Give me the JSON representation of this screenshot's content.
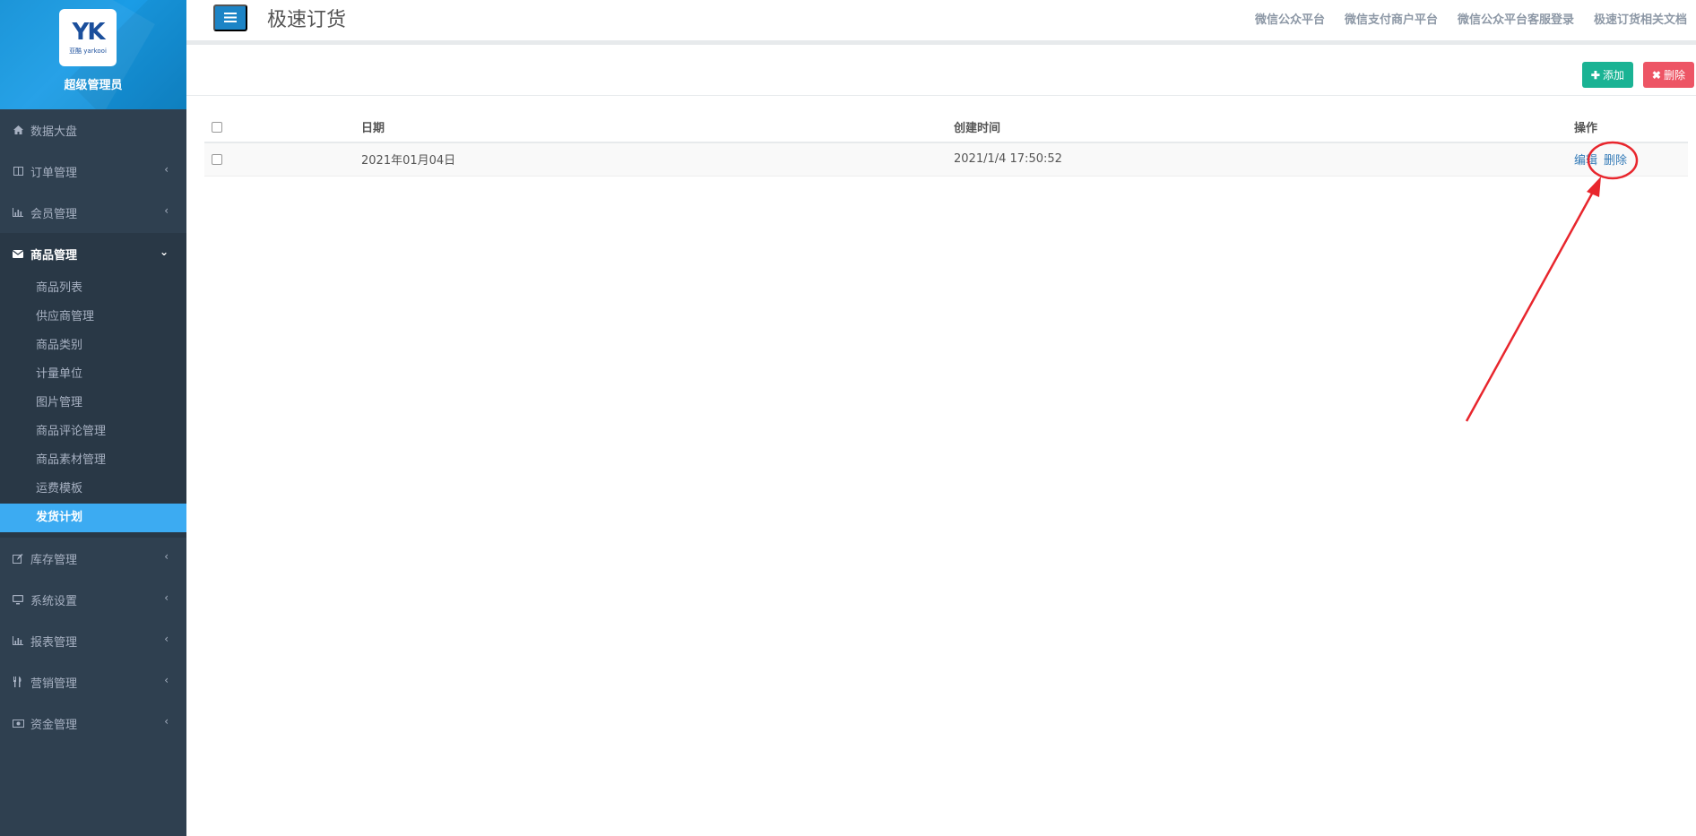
{
  "sidebar": {
    "logo_mark": "YK",
    "logo_sub": "亚酷 yarkooi",
    "profile_name": "超级管理员",
    "items": [
      {
        "label": "数据大盘",
        "icon": "home-icon",
        "has_arrow": false
      },
      {
        "label": "订单管理",
        "icon": "columns-icon",
        "has_arrow": true
      },
      {
        "label": "会员管理",
        "icon": "bar-chart-icon",
        "has_arrow": true
      },
      {
        "label": "商品管理",
        "icon": "envelope-icon",
        "has_arrow": true,
        "expanded": true
      }
    ],
    "subitems": [
      {
        "label": "商品列表"
      },
      {
        "label": "供应商管理"
      },
      {
        "label": "商品类别"
      },
      {
        "label": "计量单位"
      },
      {
        "label": "图片管理"
      },
      {
        "label": "商品评论管理"
      },
      {
        "label": "商品素材管理"
      },
      {
        "label": "运费模板"
      },
      {
        "label": "发货计划",
        "active": true
      }
    ],
    "items_after": [
      {
        "label": "库存管理",
        "icon": "edit-icon"
      },
      {
        "label": "系统设置",
        "icon": "desktop-icon"
      },
      {
        "label": "报表管理",
        "icon": "bar-chart-icon"
      },
      {
        "label": "营销管理",
        "icon": "cutlery-icon"
      },
      {
        "label": "资金管理",
        "icon": "money-icon"
      }
    ]
  },
  "header": {
    "title": "极速订货",
    "links": [
      "微信公众平台",
      "微信支付商户平台",
      "微信公众平台客服登录",
      "极速订货相关文档"
    ]
  },
  "toolbar": {
    "add_label": "添加",
    "delete_label": "删除"
  },
  "table": {
    "columns": [
      "日期",
      "创建时间",
      "操作"
    ],
    "rows": [
      {
        "date": "2021年01月04日",
        "created": "2021/1/4 17:50:52",
        "edit": "编辑",
        "delete": "删除"
      }
    ]
  },
  "colors": {
    "sidebar_bg": "#2f4050",
    "active_sub": "#3cabf2",
    "add_btn": "#1ab394",
    "del_btn": "#ed5565",
    "annotation": "#e8262d"
  }
}
